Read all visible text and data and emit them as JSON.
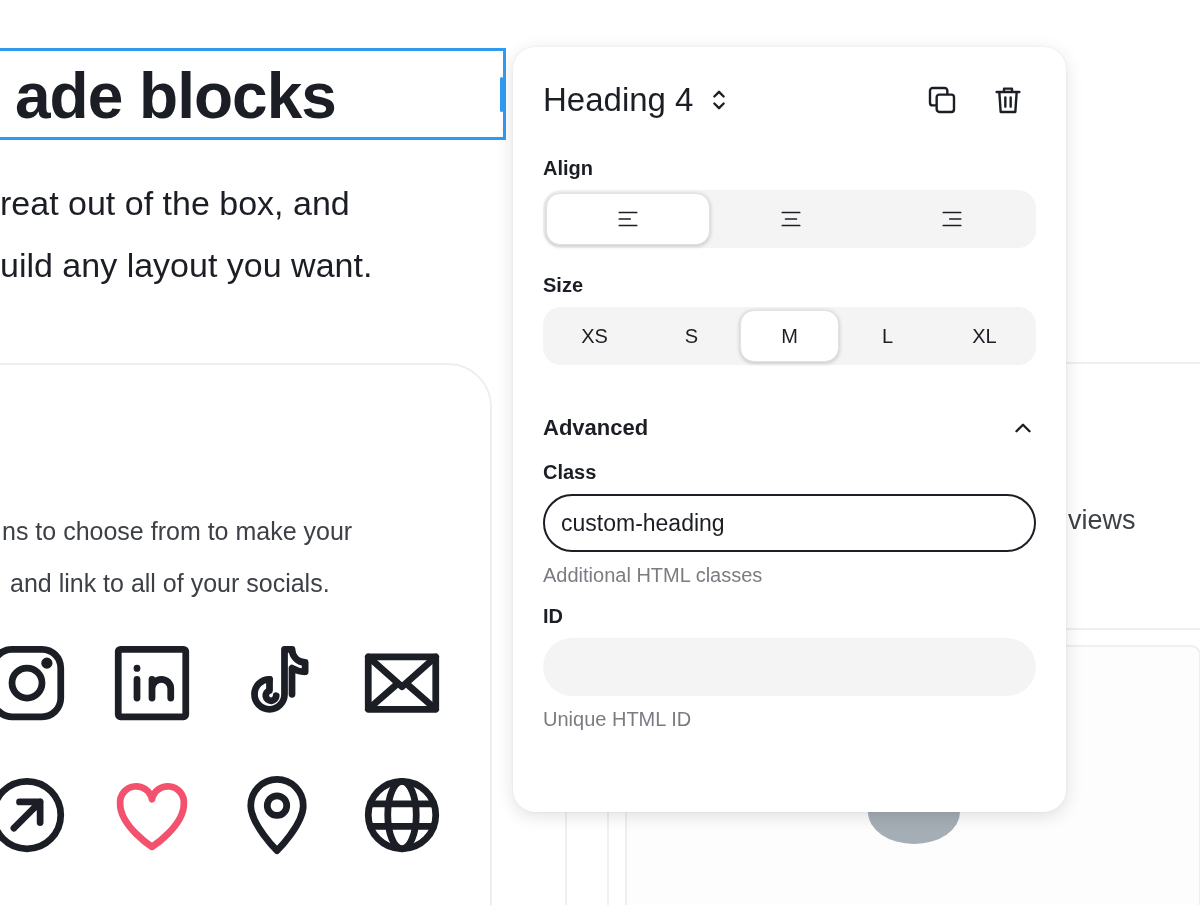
{
  "canvas": {
    "heading": {
      "text": "ade blocks",
      "selected": true
    },
    "intro_lines": [
      "reat out of the box, and",
      "uild any layout you want."
    ],
    "socials_card": {
      "text_lines": [
        "ns to choose from to make your",
        "and link to all of your socials."
      ],
      "icons": [
        {
          "kind": "instagram",
          "color": "#1b1e24"
        },
        {
          "kind": "linkedin",
          "color": "#1b1e24"
        },
        {
          "kind": "tiktok",
          "color": "#1b1e24"
        },
        {
          "kind": "mail",
          "color": "#1b1e24"
        },
        {
          "kind": "arrow",
          "color": "#1b1e24"
        },
        {
          "kind": "heart",
          "color": "#f2526d"
        },
        {
          "kind": "pin",
          "color": "#1b1e24"
        },
        {
          "kind": "globe",
          "color": "#1b1e24"
        }
      ]
    },
    "right_card": {
      "text": "views"
    }
  },
  "popover": {
    "block_type": "Heading 4",
    "align": {
      "label": "Align",
      "options": [
        {
          "kind": "left",
          "selected": true
        },
        {
          "kind": "center",
          "selected": false
        },
        {
          "kind": "right",
          "selected": false
        }
      ]
    },
    "size": {
      "label": "Size",
      "options": [
        {
          "label": "XS",
          "selected": false
        },
        {
          "label": "S",
          "selected": false
        },
        {
          "label": "M",
          "selected": true
        },
        {
          "label": "L",
          "selected": false
        },
        {
          "label": "XL",
          "selected": false
        }
      ]
    },
    "advanced": {
      "label": "Advanced",
      "expanded": true,
      "fields": [
        {
          "label": "Class",
          "value": "custom-heading",
          "focused": true,
          "hint": "Additional HTML classes"
        },
        {
          "label": "ID",
          "focused": false,
          "hint": "Unique HTML ID"
        }
      ]
    }
  }
}
